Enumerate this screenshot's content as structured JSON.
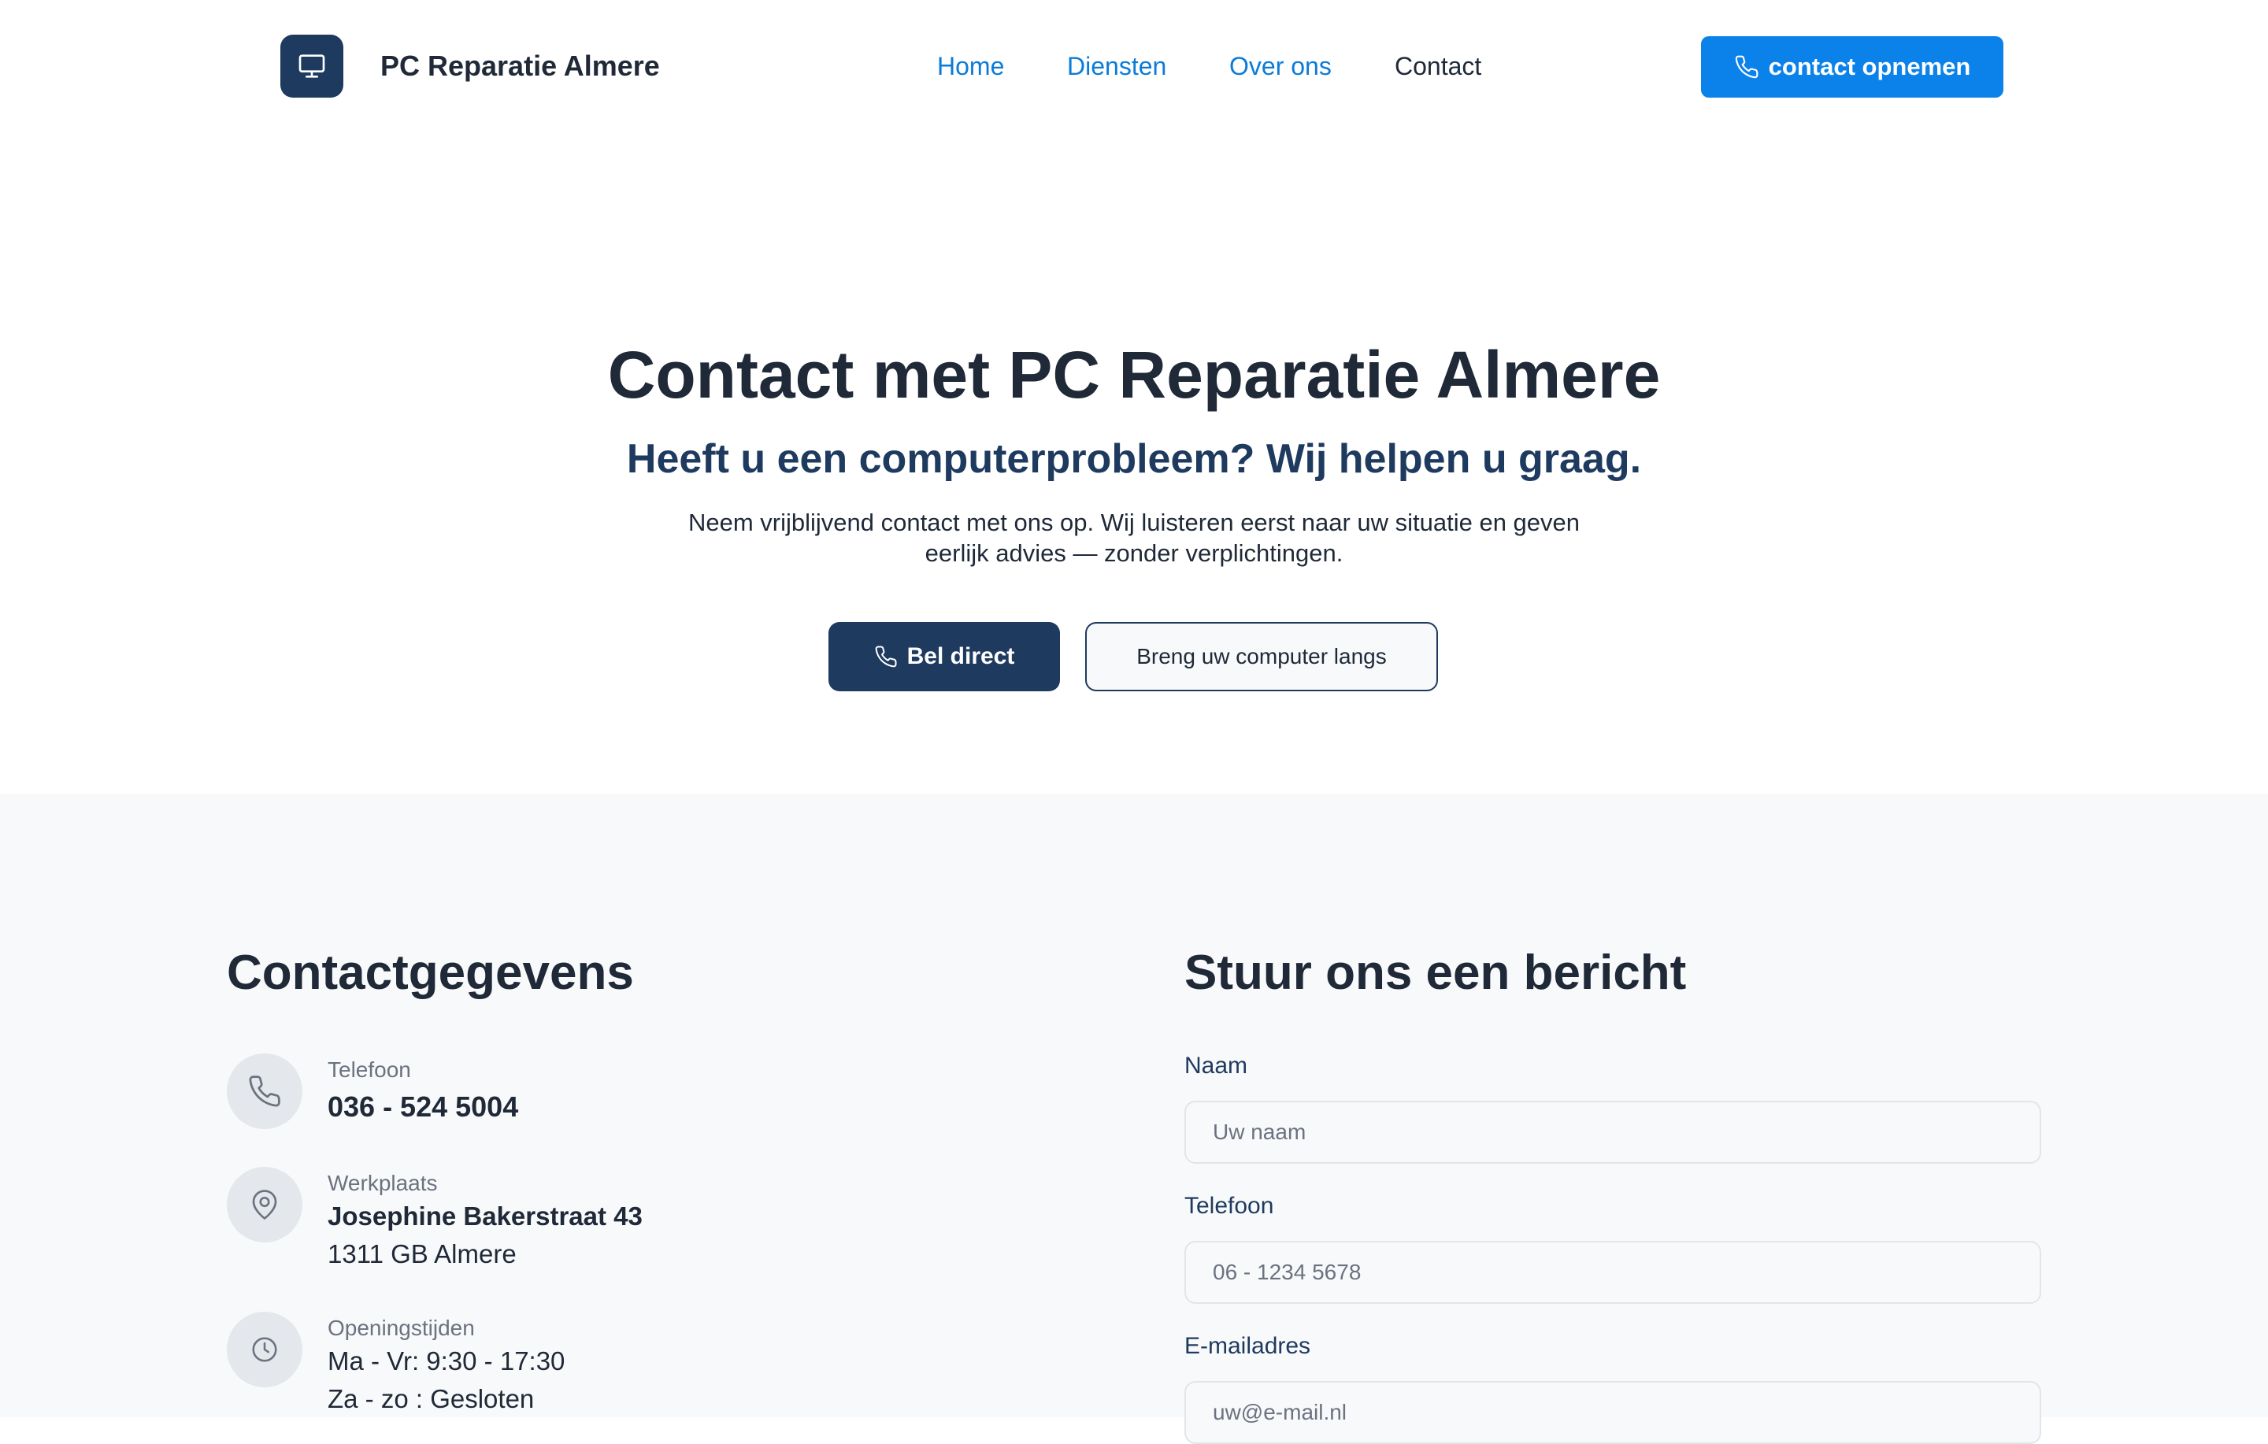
{
  "brand": {
    "name": "PC Reparatie Almere",
    "logo_icon": "monitor-icon",
    "color_primary": "#1e3a5f",
    "color_accent": "#0b82ea"
  },
  "nav": {
    "items": [
      {
        "label": "Home"
      },
      {
        "label": "Diensten"
      },
      {
        "label": "Over ons"
      },
      {
        "label": "Contact"
      }
    ],
    "active": "Contact",
    "cta_label": "contact opnemen",
    "cta_icon": "phone-icon"
  },
  "hero": {
    "title": "Contact met PC Reparatie Almere",
    "subtitle": "Heeft u een computerprobleem? Wij helpen u graag.",
    "text_line1": "Neem vrijblijvend contact met ons op. Wij luisteren eerst naar uw situatie en geven",
    "text_line2": "eerlijk advies — zonder verplichtingen.",
    "primary_button": "Bel direct",
    "secondary_button": "Breng uw computer langs"
  },
  "contact_info": {
    "title": "Contactgegevens",
    "phone": {
      "label": "Telefoon",
      "value": "036 - 524 5004",
      "icon": "phone-icon"
    },
    "workshop": {
      "label": "Werkplaats",
      "street": "Josephine Bakerstraat 43",
      "city": "1311 GB Almere",
      "icon": "map-pin-icon"
    },
    "hours": {
      "label": "Openingstijden",
      "weekdays": "Ma - Vr: 9:30 - 17:30",
      "weekend": "Za - zo : Gesloten",
      "icon": "clock-icon"
    }
  },
  "form": {
    "title": "Stuur ons een bericht",
    "name_label": "Naam",
    "name_placeholder": "Uw naam",
    "phone_label": "Telefoon",
    "phone_placeholder": "06 - 1234 5678",
    "email_label": "E-mailadres",
    "email_placeholder": "uw@e-mail.nl"
  }
}
